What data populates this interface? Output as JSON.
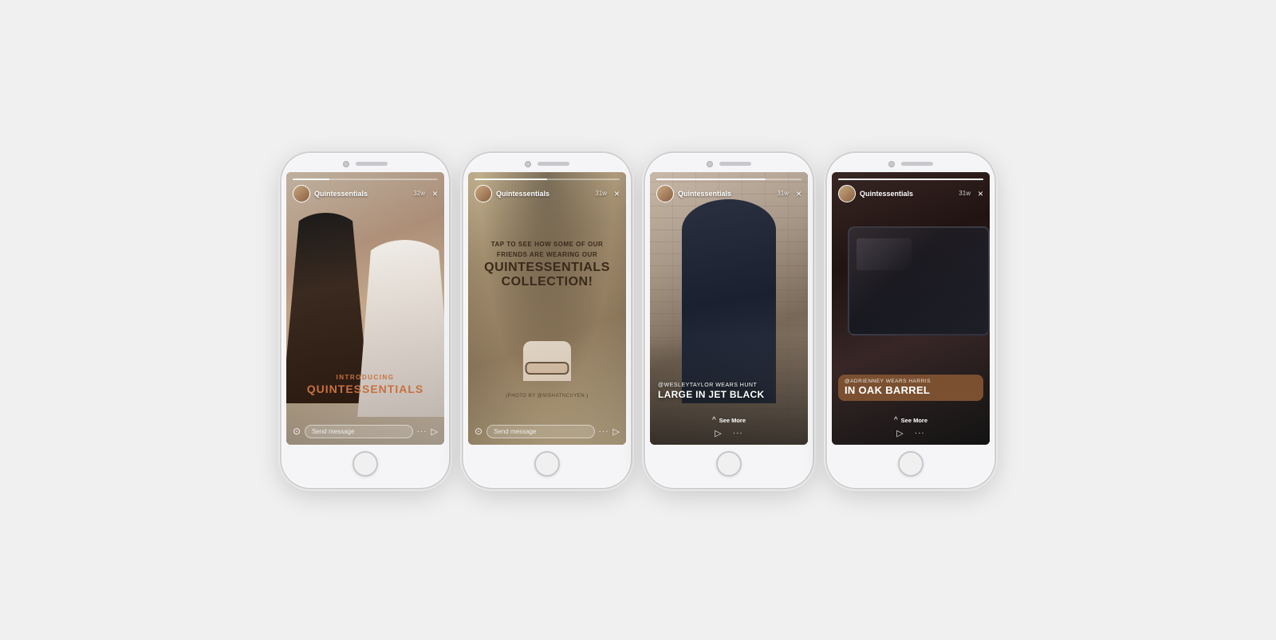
{
  "page": {
    "bg_color": "#f0f0f0"
  },
  "phones": [
    {
      "id": "phone1",
      "username": "Quintessentials",
      "time": "32w",
      "progress": 25,
      "footer_type": "message",
      "content": {
        "intro_label": "INTRODUCING",
        "brand_name": "QUINTESSENTIALS"
      }
    },
    {
      "id": "phone2",
      "username": "Quintessentials",
      "time": "31w",
      "progress": 50,
      "footer_type": "message",
      "content": {
        "tap_line1": "TAP TO SEE HOW SOME OF OUR",
        "tap_line2": "FRIENDS ARE WEARING OUR",
        "tap_brand": "QUINTESSENTIALS",
        "tap_collection": "COLLECTION!",
        "photo_credit": "(PHOTO BY @NISHATNCUYEN.)"
      }
    },
    {
      "id": "phone3",
      "username": "Quintessentials",
      "time": "31w",
      "progress": 75,
      "footer_type": "see_more",
      "content": {
        "caption_small": "@WESLEYTAYLOR WEARS HUNT",
        "caption_large": "LARGE IN JET BLACK"
      }
    },
    {
      "id": "phone4",
      "username": "Quintessentials",
      "time": "31w",
      "progress": 100,
      "footer_type": "see_more",
      "content": {
        "caption_small": "@ADRIENNEY WEARS HARRIS",
        "caption_large": "IN OAK BARREL"
      }
    }
  ],
  "ui": {
    "close_x": "×",
    "camera_icon": "📷",
    "send_icon": "➤",
    "dots_icon": "···",
    "message_placeholder": "Send message",
    "see_more_label": "See More",
    "chevron_up": "⌃"
  }
}
